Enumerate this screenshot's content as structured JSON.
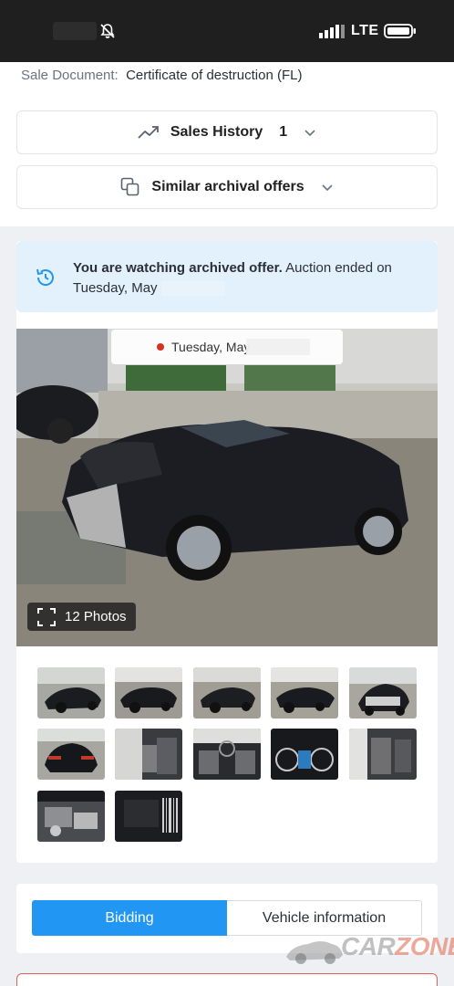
{
  "status_bar": {
    "network": "LTE"
  },
  "sale_document": {
    "label": "Sale Document:",
    "value": "Certificate of destruction (FL)"
  },
  "sales_history": {
    "label": "Sales History",
    "count": "1"
  },
  "similar_offers": {
    "label": "Similar archival offers"
  },
  "notice": {
    "bold": "You are watching archived offer.",
    "text": " Auction ended on Tuesday, May"
  },
  "photo": {
    "date": "Tuesday, May",
    "photos_label": "12 Photos",
    "photo_count": 12
  },
  "tabs": {
    "bidding": "Bidding",
    "vehicle_info": "Vehicle information",
    "active": "Bidding"
  },
  "watermark": {
    "brand_left": "CAR",
    "brand_right": "ZONE"
  },
  "colors": {
    "accent": "#2196f3",
    "notice_bg": "#e3f1fc",
    "status_dot": "#d93025"
  }
}
